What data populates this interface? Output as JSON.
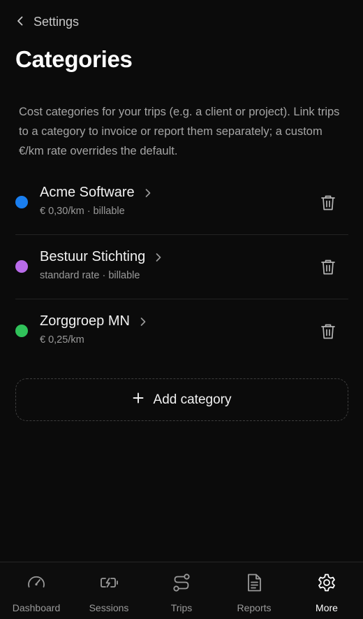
{
  "header": {
    "back_label": "Settings",
    "title": "Categories",
    "description": "Cost categories for your trips (e.g. a client or project). Link trips to a category to invoice or report them separately; a custom €/km rate overrides the default."
  },
  "categories": [
    {
      "name": "Acme Software",
      "detail": "€ 0,30/km · billable",
      "color": "#1a7ff0"
    },
    {
      "name": "Bestuur Stichting",
      "detail": "standard rate · billable",
      "color": "#b96bea"
    },
    {
      "name": "Zorggroep MN",
      "detail": "€ 0,25/km",
      "color": "#30c25a"
    }
  ],
  "add_button": {
    "label": "Add category"
  },
  "tabbar": {
    "active": "More",
    "items": [
      {
        "label": "Dashboard",
        "icon": "speedometer-icon"
      },
      {
        "label": "Sessions",
        "icon": "battery-charging-icon"
      },
      {
        "label": "Trips",
        "icon": "route-icon"
      },
      {
        "label": "Reports",
        "icon": "document-icon"
      },
      {
        "label": "More",
        "icon": "gear-icon"
      }
    ]
  },
  "colors": {
    "background": "#0b0b0b",
    "text_primary": "#f2f2f2",
    "text_secondary": "#9a9a9a"
  }
}
